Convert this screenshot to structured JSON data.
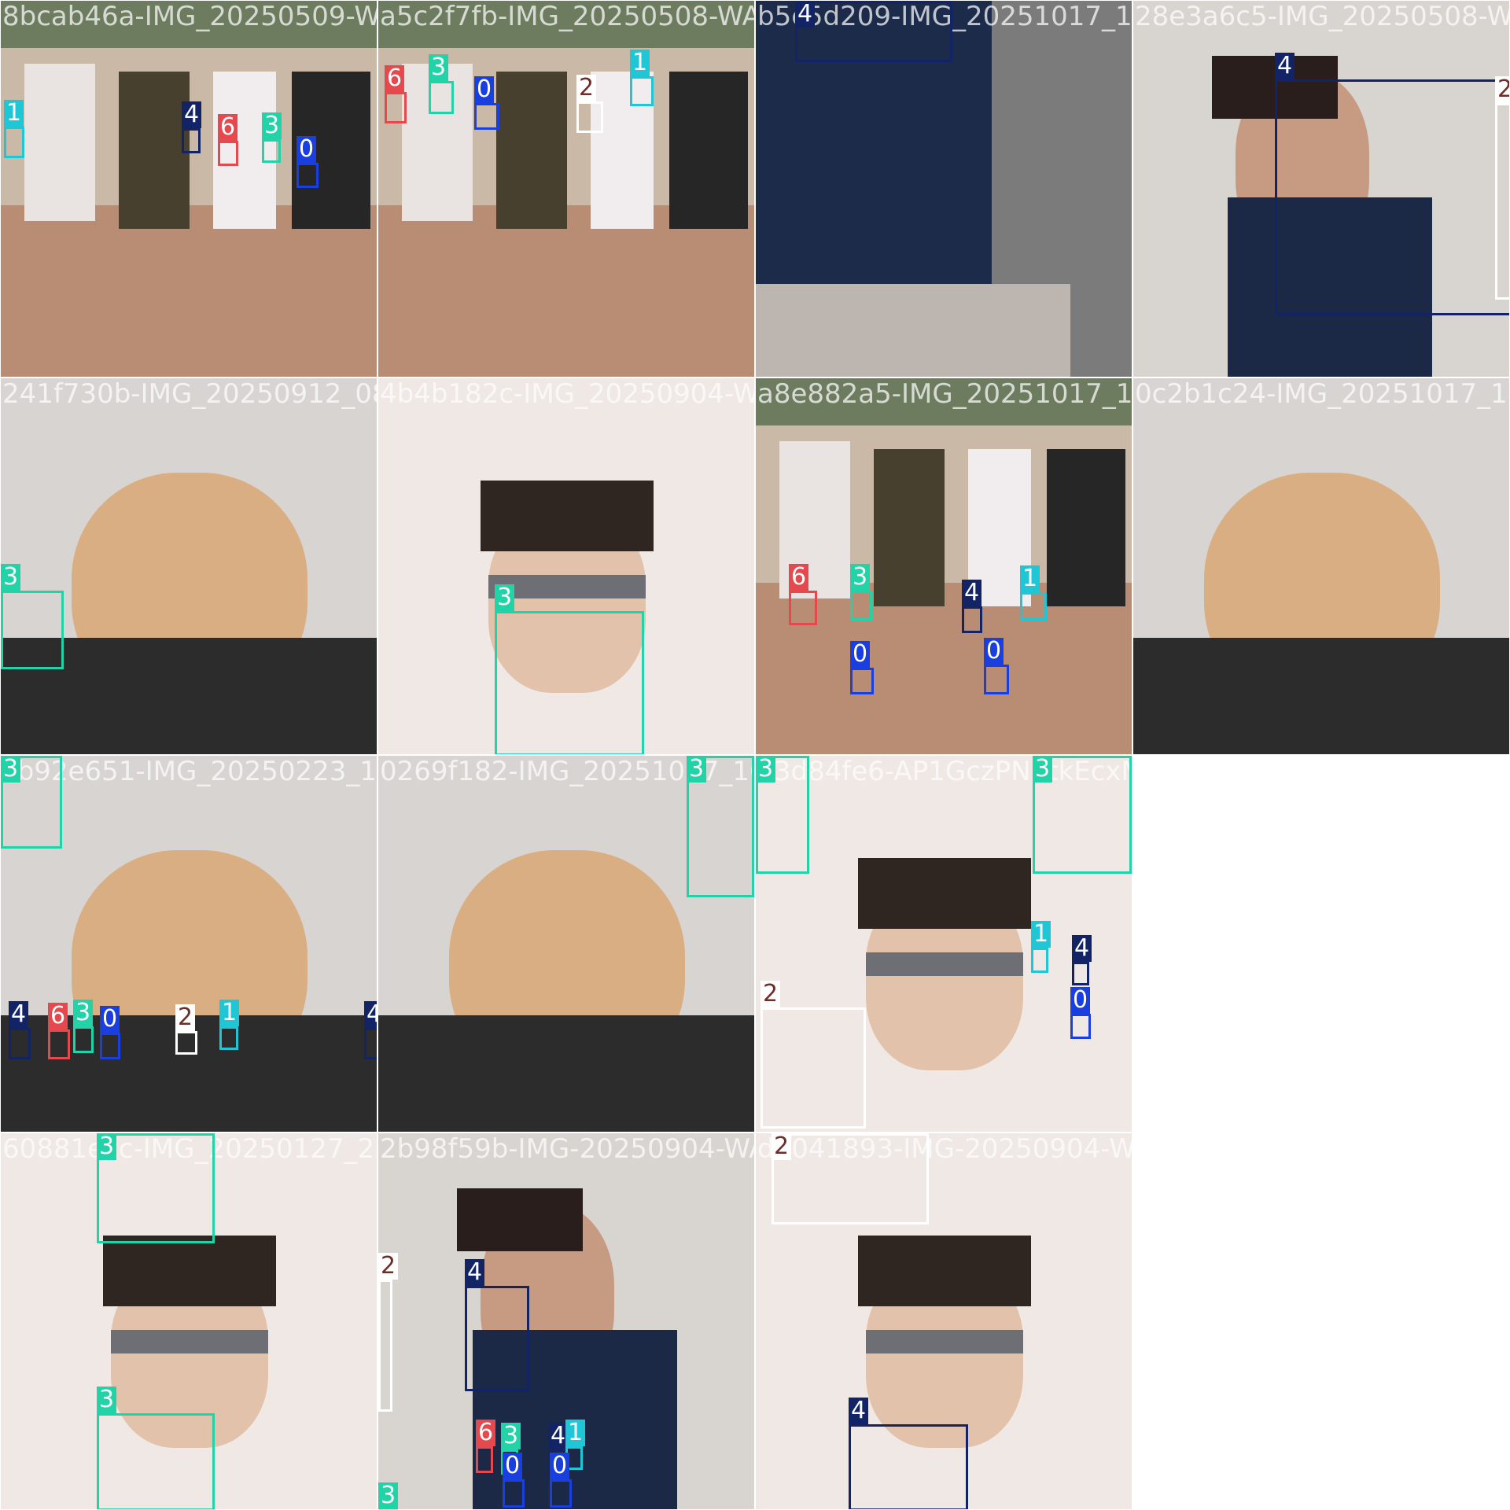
{
  "tiles": [
    {
      "filename": "8bcab46a-IMG_20250509-WA0014.jpg",
      "scene": "group"
    },
    {
      "filename": "a5c2f7fb-IMG_20250508-WA0019.jpg",
      "scene": "group"
    },
    {
      "filename": "b5c5d209-IMG_20251017_123763.jpg",
      "scene": "jacket"
    },
    {
      "filename": "28e3a6c5-IMG_20250508-WA0016.jpg",
      "scene": "portrait"
    },
    {
      "filename": "241f730b-IMG_20250912_084518.jpg",
      "scene": "cat"
    },
    {
      "filename": "4b4b182c-IMG_20250904-WA0008.jpg",
      "scene": "face"
    },
    {
      "filename": "a8e882a5-IMG_20251017_105826.jpg",
      "scene": "group"
    },
    {
      "filename": "0c2b1c24-IMG_20251017_1",
      "scene": "cat"
    },
    {
      "filename": "cb92e651-IMG_20250223_160951.jpg",
      "scene": "cat"
    },
    {
      "filename": "0269f182-IMG_20251017_102724.jpg",
      "scene": "cat"
    },
    {
      "filename": "e3d84fe6-AP1GczPNptkEcxM7qDq_m0d0AHdcqP",
      "scene": "face"
    },
    {
      "filename": "",
      "scene": "empty"
    },
    {
      "filename": "60881ecc-IMG_20250127_224948.jpg",
      "scene": "face"
    },
    {
      "filename": "2b98f59b-IMG-20250904-WA0018.jpg",
      "scene": "portrait"
    },
    {
      "filename": "d6041893-IMG-20250904-WA0016.jpg",
      "scene": "face"
    },
    {
      "filename": "",
      "scene": "empty"
    }
  ],
  "classes": {
    "0": {
      "label": "0",
      "color": "#1a3fe0"
    },
    "1": {
      "label": "1",
      "color": "#1fc6d6"
    },
    "2": {
      "label": "2",
      "color": "#ffffff"
    },
    "3": {
      "label": "3",
      "color": "#22d3a8"
    },
    "4": {
      "label": "4",
      "color": "#132466"
    },
    "6": {
      "label": "6",
      "color": "#e5484d"
    }
  },
  "detections": [
    {
      "tile": 0,
      "cls": "1"
    },
    {
      "tile": 0,
      "cls": "4"
    },
    {
      "tile": 0,
      "cls": "6"
    },
    {
      "tile": 0,
      "cls": "3"
    },
    {
      "tile": 0,
      "cls": "0"
    },
    {
      "tile": 1,
      "cls": "6"
    },
    {
      "tile": 1,
      "cls": "3"
    },
    {
      "tile": 1,
      "cls": "0"
    },
    {
      "tile": 1,
      "cls": "2"
    },
    {
      "tile": 1,
      "cls": "1"
    },
    {
      "tile": 2,
      "cls": "4"
    },
    {
      "tile": 3,
      "cls": "4"
    },
    {
      "tile": 3,
      "cls": "2"
    },
    {
      "tile": 4,
      "cls": "3"
    },
    {
      "tile": 5,
      "cls": "3"
    },
    {
      "tile": 6,
      "cls": "6"
    },
    {
      "tile": 6,
      "cls": "3"
    },
    {
      "tile": 6,
      "cls": "4"
    },
    {
      "tile": 6,
      "cls": "1"
    },
    {
      "tile": 6,
      "cls": "0"
    },
    {
      "tile": 6,
      "cls": "0"
    },
    {
      "tile": 6,
      "cls": "3"
    },
    {
      "tile": 8,
      "cls": "3"
    },
    {
      "tile": 8,
      "cls": "4"
    },
    {
      "tile": 8,
      "cls": "6"
    },
    {
      "tile": 8,
      "cls": "3"
    },
    {
      "tile": 8,
      "cls": "0"
    },
    {
      "tile": 8,
      "cls": "2"
    },
    {
      "tile": 8,
      "cls": "1"
    },
    {
      "tile": 8,
      "cls": "4"
    },
    {
      "tile": 8,
      "cls": "3"
    },
    {
      "tile": 9,
      "cls": "3"
    },
    {
      "tile": 10,
      "cls": "3"
    },
    {
      "tile": 10,
      "cls": "3"
    },
    {
      "tile": 10,
      "cls": "1"
    },
    {
      "tile": 10,
      "cls": "4"
    },
    {
      "tile": 10,
      "cls": "0"
    },
    {
      "tile": 10,
      "cls": "2"
    },
    {
      "tile": 12,
      "cls": "3"
    },
    {
      "tile": 12,
      "cls": "3"
    },
    {
      "tile": 13,
      "cls": "2"
    },
    {
      "tile": 13,
      "cls": "4"
    },
    {
      "tile": 13,
      "cls": "6"
    },
    {
      "tile": 13,
      "cls": "3"
    },
    {
      "tile": 13,
      "cls": "4"
    },
    {
      "tile": 13,
      "cls": "1"
    },
    {
      "tile": 13,
      "cls": "0"
    },
    {
      "tile": 13,
      "cls": "0"
    },
    {
      "tile": 13,
      "cls": "3"
    },
    {
      "tile": 14,
      "cls": "2"
    },
    {
      "tile": 14,
      "cls": "4"
    }
  ]
}
